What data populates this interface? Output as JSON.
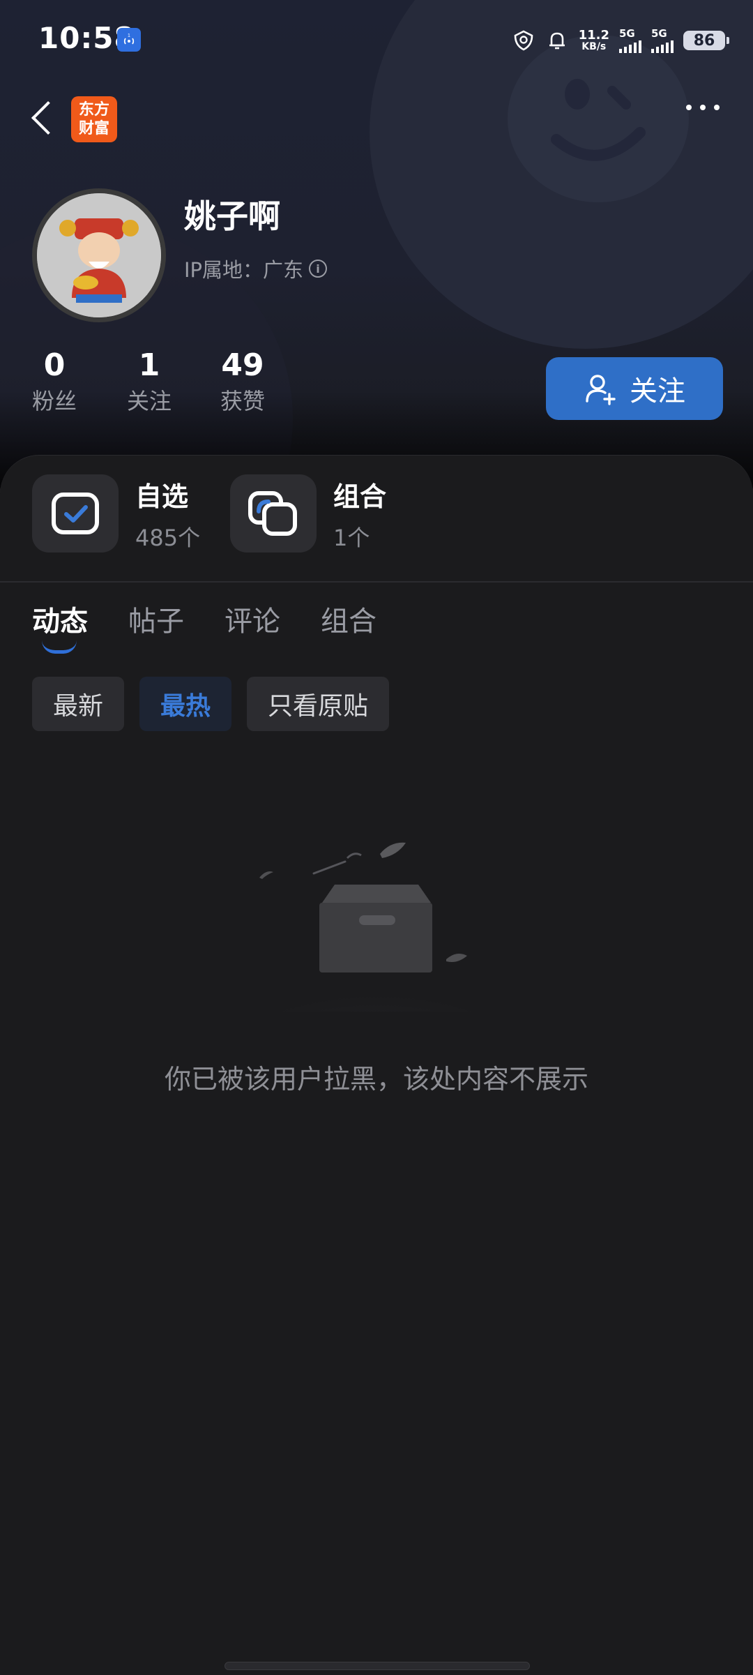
{
  "status_bar": {
    "time": "10:58",
    "hotspot_badge": "1",
    "net_speed_value": "11.2",
    "net_speed_unit": "KB/s",
    "sim1_label": "5G",
    "sim2_label": "5G",
    "battery": "86"
  },
  "nav": {
    "logo_line1": "东方",
    "logo_line2": "财富"
  },
  "profile": {
    "username": "姚子啊",
    "ip_location": "IP属地：广东"
  },
  "stats": [
    {
      "value": "0",
      "label": "粉丝"
    },
    {
      "value": "1",
      "label": "关注"
    },
    {
      "value": "49",
      "label": "获赞"
    }
  ],
  "follow_button": {
    "label": "关注"
  },
  "shortcuts": [
    {
      "title": "自选",
      "sub": "485个",
      "icon": "checkbox-icon"
    },
    {
      "title": "组合",
      "sub": "1个",
      "icon": "portfolio-icon"
    }
  ],
  "tabs": [
    "动态",
    "帖子",
    "评论",
    "组合"
  ],
  "filter_chips": [
    "最新",
    "最热",
    "只看原贴"
  ],
  "empty_state": {
    "message": "你已被该用户拉黑，该处内容不展示"
  },
  "colors": {
    "accent": "#2f6fc7",
    "background": "#1b1b1d",
    "brand_logo": "#f05a1a"
  }
}
